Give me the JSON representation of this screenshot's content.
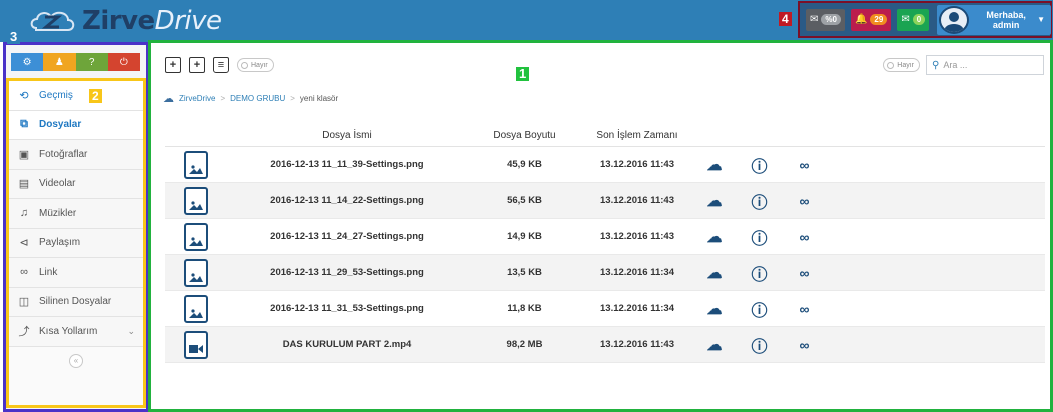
{
  "header": {
    "logo_text_bold": "Zirve",
    "logo_text_light": "Drive",
    "notifications": [
      {
        "icon": "envelope-icon",
        "count": "%0"
      },
      {
        "icon": "bell-icon",
        "count": "29"
      },
      {
        "icon": "mail-icon",
        "count": "0"
      }
    ],
    "user_greeting_line1": "Merhaba,",
    "user_greeting_line2": "admin"
  },
  "labels": {
    "one": "1",
    "two": "2",
    "three": "3",
    "four": "4"
  },
  "sidebar": {
    "items": [
      {
        "label": "Geçmiş",
        "icon": "history-icon"
      },
      {
        "label": "Dosyalar",
        "icon": "files-icon"
      },
      {
        "label": "Fotoğraflar",
        "icon": "photo-icon"
      },
      {
        "label": "Videolar",
        "icon": "video-icon"
      },
      {
        "label": "Müzikler",
        "icon": "music-icon"
      },
      {
        "label": "Paylaşım",
        "icon": "share-icon"
      },
      {
        "label": "Link",
        "icon": "link-icon"
      },
      {
        "label": "Silinen Dosyalar",
        "icon": "trash-icon"
      },
      {
        "label": "Kısa Yollarım",
        "icon": "bolt-icon"
      }
    ]
  },
  "toolbar": {
    "toggle_label": "Hayır"
  },
  "search": {
    "toggle_label": "Hayır",
    "placeholder": "Ara ..."
  },
  "breadcrumb": {
    "items": [
      "ZirveDrive",
      "DEMO GRUBU",
      "yeni klasör"
    ]
  },
  "table": {
    "headers": {
      "name": "Dosya İsmi",
      "size": "Dosya Boyutu",
      "time": "Son İşlem Zamanı"
    },
    "rows": [
      {
        "name": "2016-12-13 11_11_39-Settings.png",
        "size": "45,9 KB",
        "time": "13.12.2016 11:43",
        "type": "image"
      },
      {
        "name": "2016-12-13 11_14_22-Settings.png",
        "size": "56,5 KB",
        "time": "13.12.2016 11:43",
        "type": "image"
      },
      {
        "name": "2016-12-13 11_24_27-Settings.png",
        "size": "14,9 KB",
        "time": "13.12.2016 11:43",
        "type": "image"
      },
      {
        "name": "2016-12-13 11_29_53-Settings.png",
        "size": "13,5 KB",
        "time": "13.12.2016 11:34",
        "type": "image"
      },
      {
        "name": "2016-12-13 11_31_53-Settings.png",
        "size": "11,8 KB",
        "time": "13.12.2016 11:34",
        "type": "image"
      },
      {
        "name": "DAS KURULUM PART 2.mp4",
        "size": "98,2 MB",
        "time": "13.12.2016 11:43",
        "type": "video"
      }
    ]
  }
}
